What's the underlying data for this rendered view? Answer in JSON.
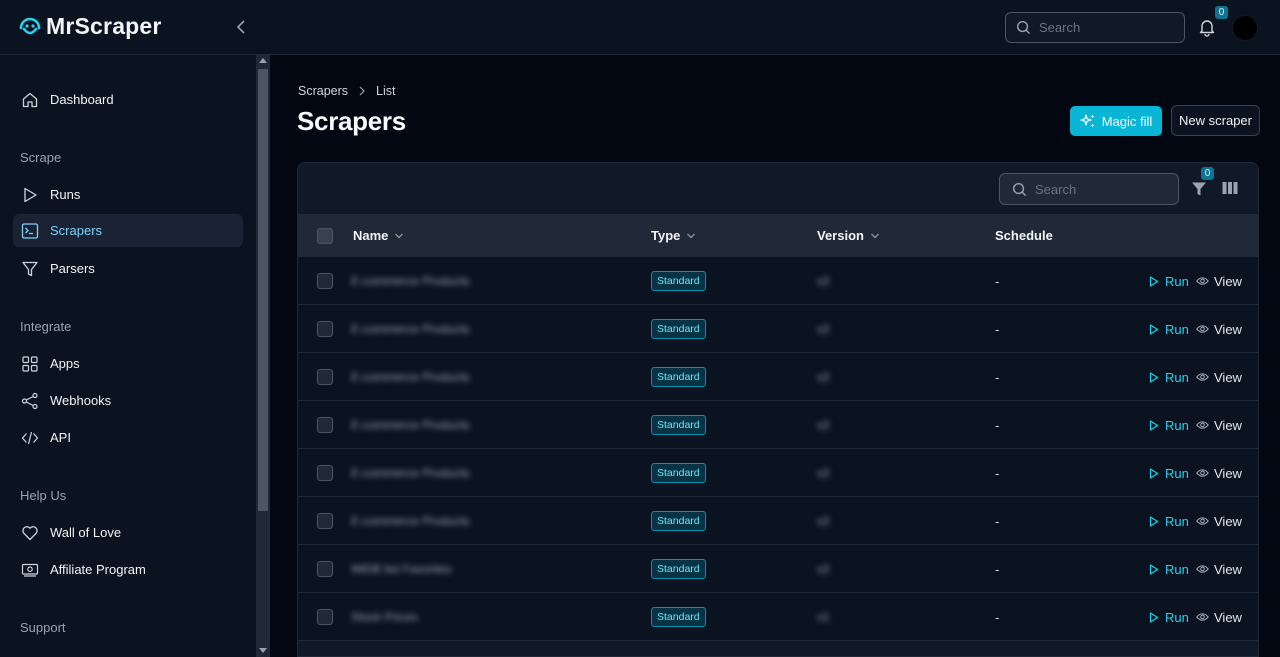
{
  "app": {
    "name": "MrScraper"
  },
  "header": {
    "search_placeholder": "Search",
    "notification_count": "0"
  },
  "sidebar": {
    "items_top": [
      {
        "label": "Dashboard",
        "icon": "home-icon"
      }
    ],
    "sections": [
      {
        "label": "Scrape",
        "items": [
          {
            "label": "Runs",
            "icon": "play-icon"
          },
          {
            "label": "Scrapers",
            "icon": "terminal-icon",
            "active": true
          },
          {
            "label": "Parsers",
            "icon": "funnel-icon"
          }
        ]
      },
      {
        "label": "Integrate",
        "items": [
          {
            "label": "Apps",
            "icon": "grid-icon"
          },
          {
            "label": "Webhooks",
            "icon": "share-icon"
          },
          {
            "label": "API",
            "icon": "code-icon"
          }
        ]
      },
      {
        "label": "Help Us",
        "items": [
          {
            "label": "Wall of Love",
            "icon": "heart-icon"
          },
          {
            "label": "Affiliate Program",
            "icon": "money-icon"
          }
        ]
      },
      {
        "label": "Support",
        "items": []
      }
    ]
  },
  "main": {
    "breadcrumb": [
      "Scrapers",
      "List"
    ],
    "title": "Scrapers",
    "magic_fill_label": "Magic fill",
    "new_scraper_label": "New scraper"
  },
  "table": {
    "search_placeholder": "Search",
    "filter_count": "0",
    "columns": [
      "Name",
      "Type",
      "Version",
      "Schedule"
    ],
    "rows": [
      {
        "name": "E-commerce Products",
        "type": "Standard",
        "version": "v2",
        "schedule": "-",
        "run": "Run",
        "view": "View"
      },
      {
        "name": "E-commerce Products",
        "type": "Standard",
        "version": "v2",
        "schedule": "-",
        "run": "Run",
        "view": "View"
      },
      {
        "name": "E-commerce Products",
        "type": "Standard",
        "version": "v2",
        "schedule": "-",
        "run": "Run",
        "view": "View"
      },
      {
        "name": "E-commerce Products",
        "type": "Standard",
        "version": "v2",
        "schedule": "-",
        "run": "Run",
        "view": "View"
      },
      {
        "name": "E-commerce Products",
        "type": "Standard",
        "version": "v2",
        "schedule": "-",
        "run": "Run",
        "view": "View"
      },
      {
        "name": "E-commerce Products",
        "type": "Standard",
        "version": "v2",
        "schedule": "-",
        "run": "Run",
        "view": "View"
      },
      {
        "name": "IMDB list Favorites",
        "type": "Standard",
        "version": "v2",
        "schedule": "-",
        "run": "Run",
        "view": "View"
      },
      {
        "name": "Stock Prices",
        "type": "Standard",
        "version": "v1",
        "schedule": "-",
        "run": "Run",
        "view": "View"
      }
    ]
  },
  "colors": {
    "accent": "#06b6d4",
    "background": "#030712",
    "panel": "#0b1220"
  }
}
